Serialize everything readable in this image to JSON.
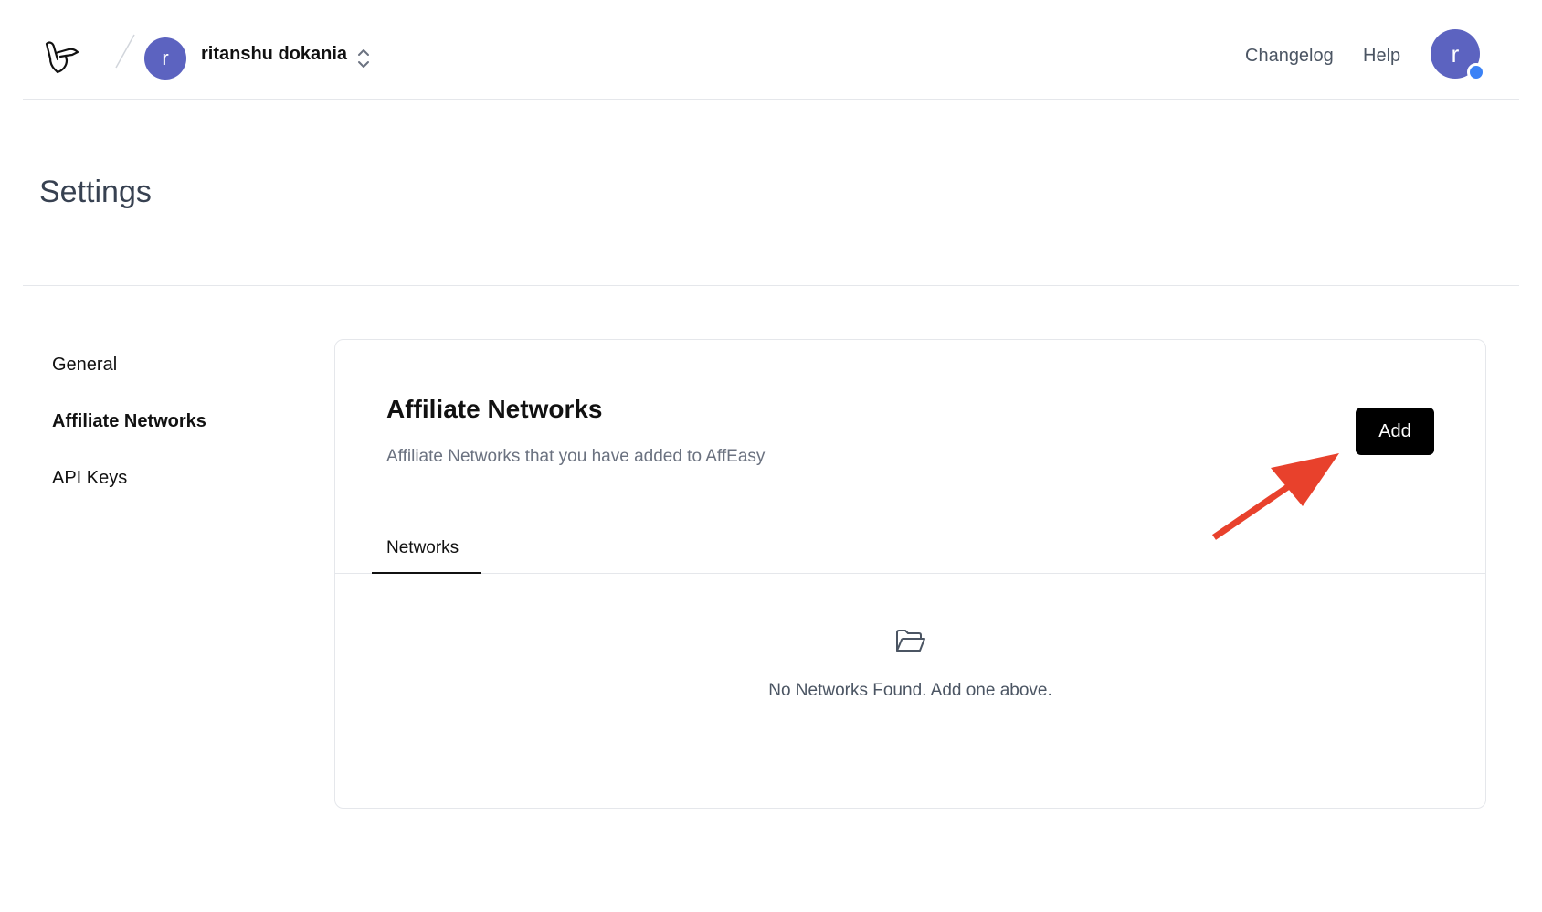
{
  "header": {
    "org_avatar_letter": "r",
    "org_name": "ritanshu dokania",
    "nav": {
      "changelog": "Changelog",
      "help": "Help"
    },
    "user_avatar_letter": "r"
  },
  "page": {
    "title": "Settings"
  },
  "sidebar": {
    "items": [
      {
        "label": "General",
        "active": false
      },
      {
        "label": "Affiliate Networks",
        "active": true
      },
      {
        "label": "API Keys",
        "active": false
      }
    ]
  },
  "card": {
    "title": "Affiliate Networks",
    "subtitle": "Affiliate Networks that you have added to AffEasy",
    "add_label": "Add",
    "tabs": [
      {
        "label": "Networks",
        "active": true
      }
    ],
    "empty_text": "No Networks Found. Add one above."
  },
  "icons": {
    "logo": "shaka-hand-logo-icon",
    "org_switch": "chevron-up-down-icon",
    "empty": "folder-open-icon",
    "annotation": "red-arrow-icon"
  },
  "colors": {
    "avatar_bg": "#5c63c0",
    "status_dot": "#3b82f6",
    "primary_button": "#000000",
    "annotation_arrow": "#e8412c",
    "muted_text": "#6b7280",
    "border": "#e5e7eb"
  }
}
